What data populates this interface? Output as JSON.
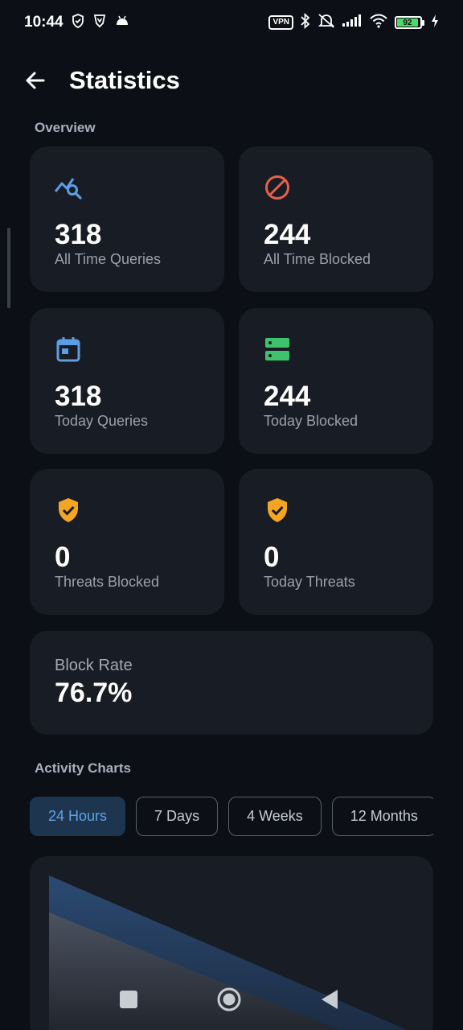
{
  "status_bar": {
    "time": "10:44",
    "vpn_label": "VPN",
    "battery_level": "92",
    "battery_fraction": 0.92
  },
  "app_bar": {
    "title": "Statistics"
  },
  "overview": {
    "section_title": "Overview",
    "cards": [
      {
        "value": "318",
        "label": "All Time Queries",
        "icon": "query-search-icon",
        "color": "#5b9ee6"
      },
      {
        "value": "244",
        "label": "All Time Blocked",
        "icon": "block-icon",
        "color": "#e5614a"
      },
      {
        "value": "318",
        "label": "Today Queries",
        "icon": "calendar-icon",
        "color": "#5b9ee6"
      },
      {
        "value": "244",
        "label": "Today Blocked",
        "icon": "dns-server-icon",
        "color": "#3ec26b"
      },
      {
        "value": "0",
        "label": "Threats Blocked",
        "icon": "shield-check-icon",
        "color": "#f5a524"
      },
      {
        "value": "0",
        "label": "Today Threats",
        "icon": "shield-check-icon",
        "color": "#f5a524"
      }
    ],
    "block_rate": {
      "label": "Block Rate",
      "value": "76.7%"
    }
  },
  "activity": {
    "section_title": "Activity Charts",
    "ranges": [
      "24 Hours",
      "7 Days",
      "4 Weeks",
      "12 Months"
    ],
    "selected_range": "24 Hours"
  },
  "colors": {
    "background": "#0c0f15",
    "card": "#181c24",
    "accent_blue": "#5ea3e8",
    "chip_active_bg": "#1e3550"
  },
  "nav": {
    "recents": "recents-icon",
    "home": "home-icon",
    "back": "back-icon"
  }
}
